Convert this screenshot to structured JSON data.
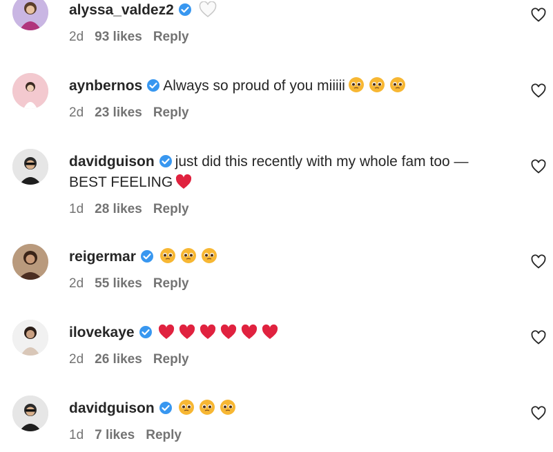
{
  "comments": [
    {
      "username": "alyssa_valdez2",
      "text": "",
      "emoji": "white-heart",
      "emoji_count": 1,
      "time": "2d",
      "likes": "93 likes",
      "reply": "Reply"
    },
    {
      "username": "aynbernos",
      "text": "Always so proud of you miiiii",
      "emoji": "pleading-face",
      "emoji_count": 3,
      "time": "2d",
      "likes": "23 likes",
      "reply": "Reply"
    },
    {
      "username": "davidguison",
      "text": "just did this recently with my whole fam too —",
      "text2": "BEST FEELING",
      "emoji": "red-heart",
      "emoji_count": 1,
      "time": "1d",
      "likes": "28 likes",
      "reply": "Reply"
    },
    {
      "username": "reigermar",
      "text": "",
      "emoji": "pleading-face",
      "emoji_count": 3,
      "time": "2d",
      "likes": "55 likes",
      "reply": "Reply"
    },
    {
      "username": "ilovekaye",
      "text": "",
      "emoji": "red-heart",
      "emoji_count": 6,
      "time": "2d",
      "likes": "26 likes",
      "reply": "Reply"
    },
    {
      "username": "davidguison",
      "text": "",
      "emoji": "pleading-face",
      "emoji_count": 3,
      "time": "1d",
      "likes": "7 likes",
      "reply": "Reply"
    }
  ],
  "colors": {
    "verified": "#3897f0",
    "text": "#262626",
    "meta": "#737373",
    "heart": "#e0223f",
    "emoji": "#f7b733"
  }
}
